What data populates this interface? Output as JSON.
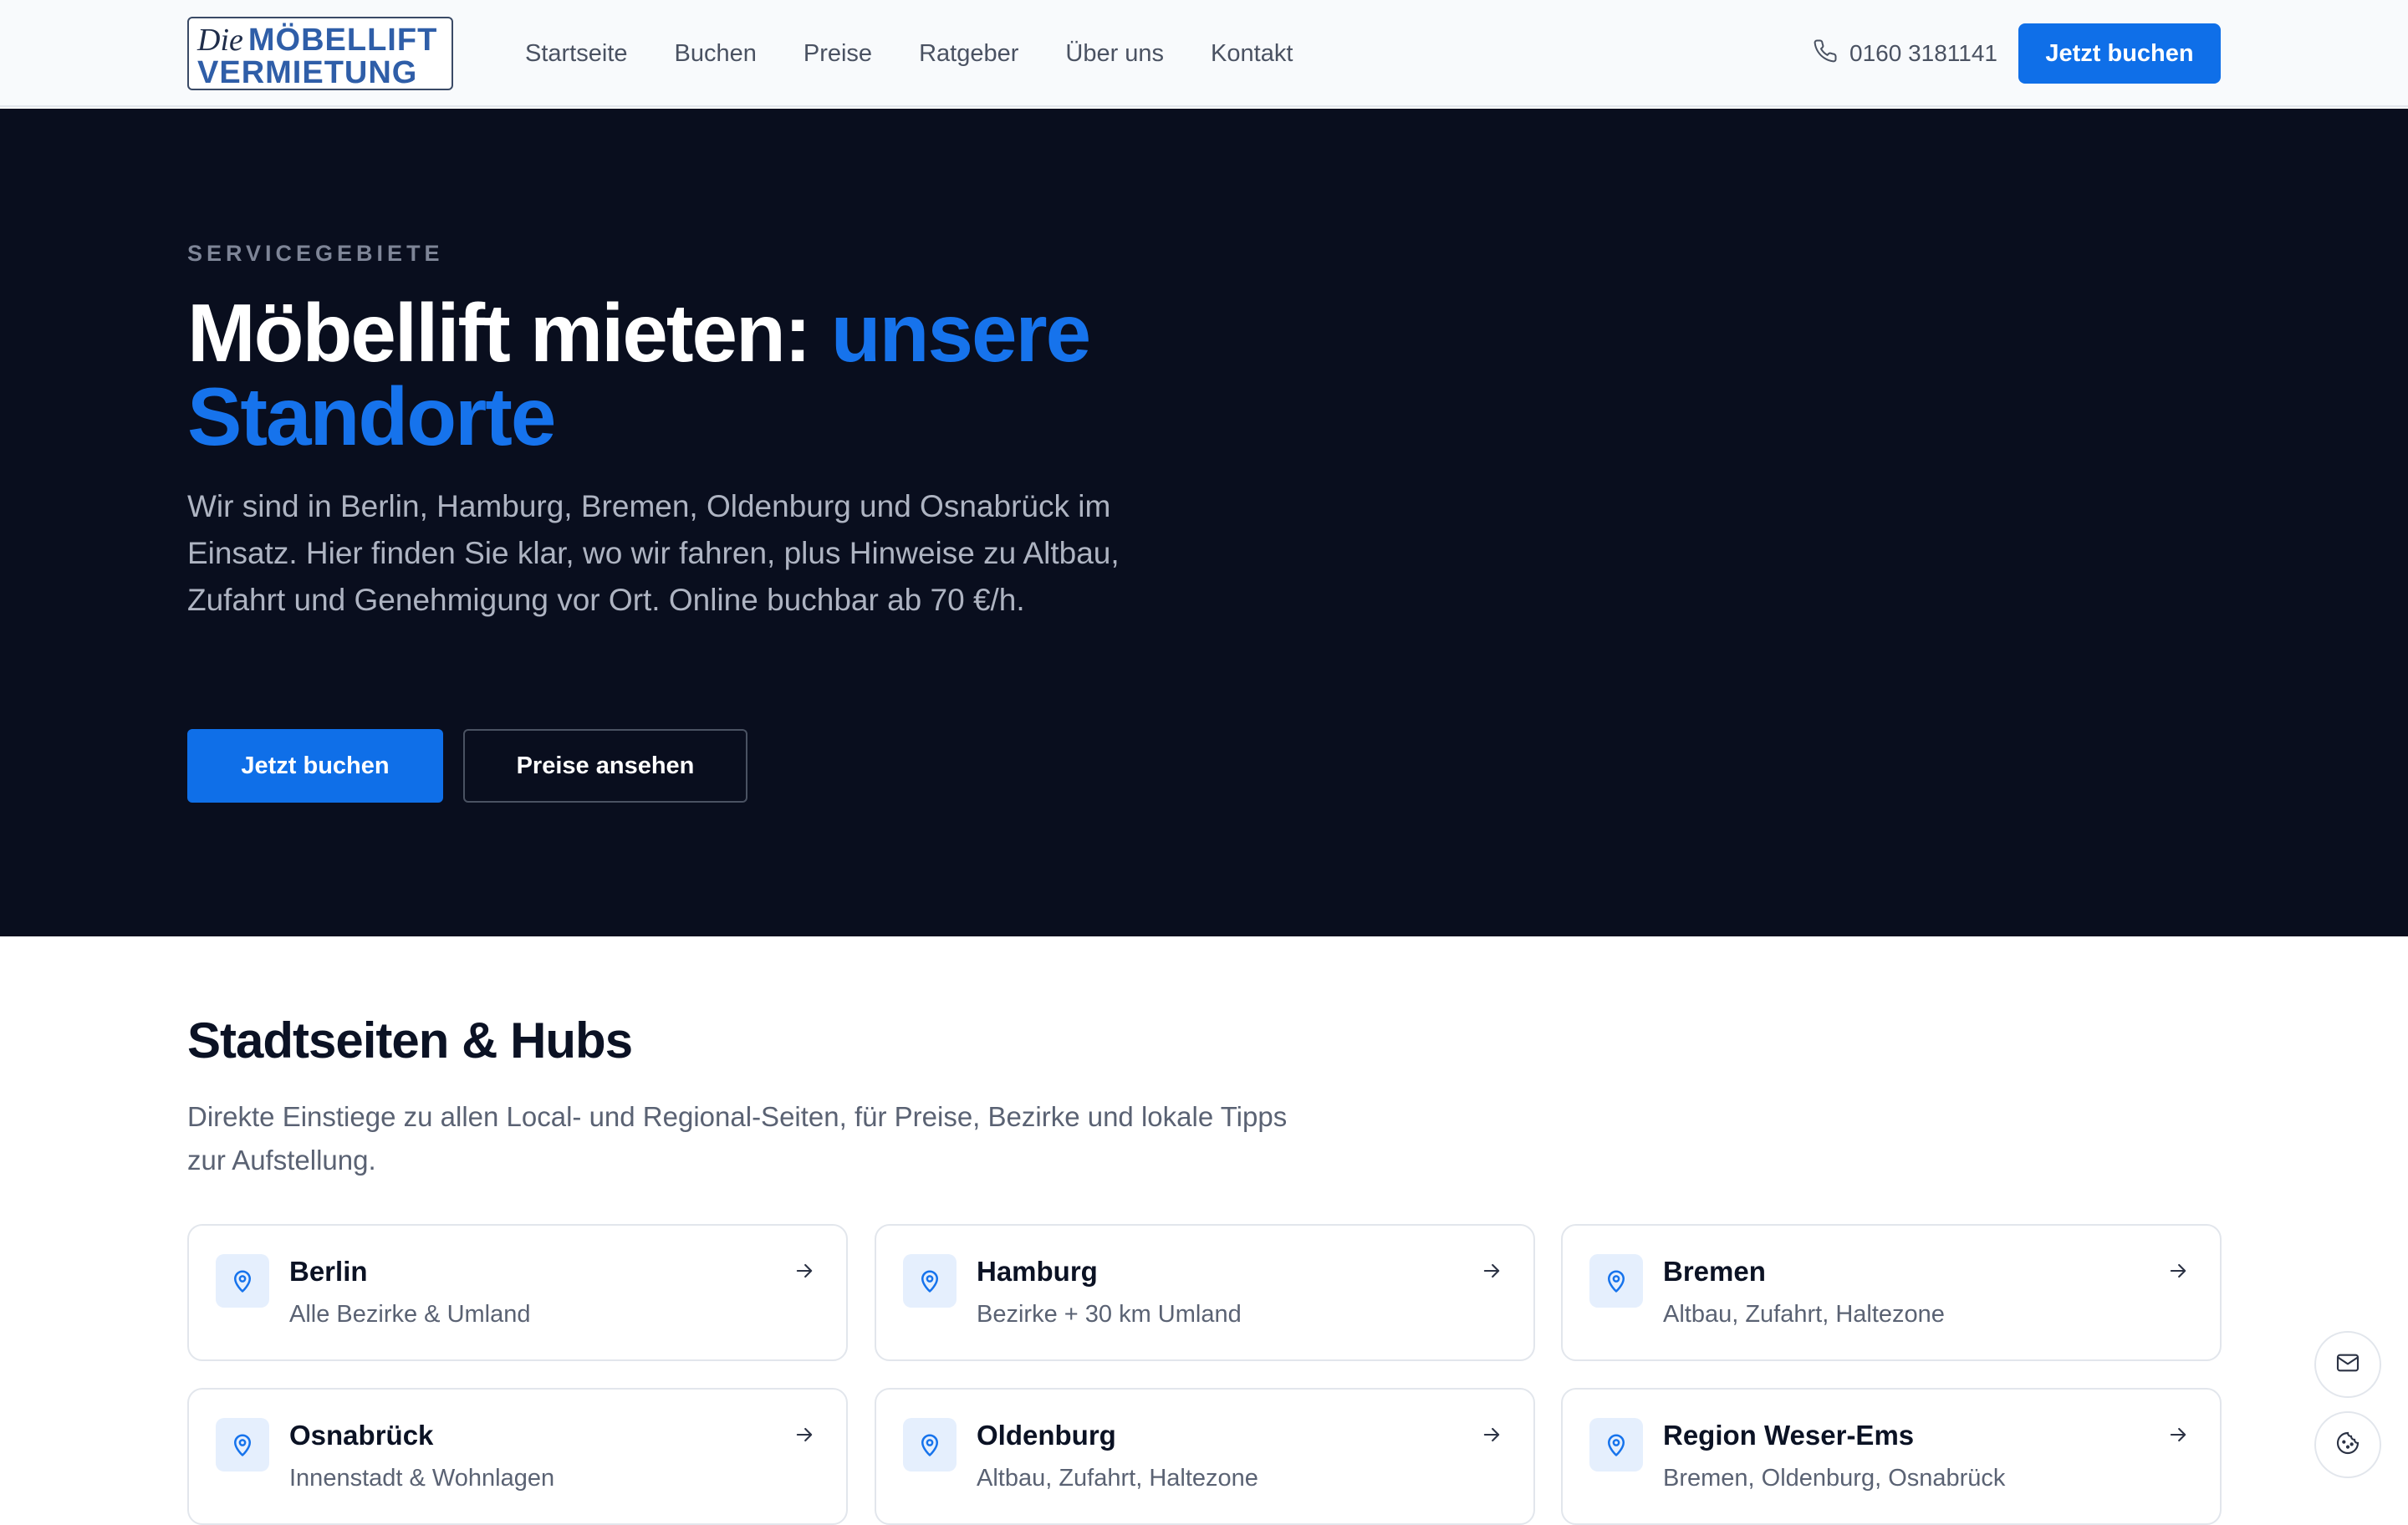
{
  "nav": {
    "logo": {
      "line1_script": "Die",
      "line1_bold": "MÖBELLIFT",
      "line2": "VERMIETUNG"
    },
    "links": [
      "Startseite",
      "Buchen",
      "Preise",
      "Ratgeber",
      "Über uns",
      "Kontakt"
    ],
    "phone": "0160 3181141",
    "cta": "Jetzt buchen"
  },
  "hero": {
    "eyebrow": "SERVICEGEBIETE",
    "title_white": "Möbellift mieten:",
    "title_accent": "unsere Standorte",
    "lead": "Wir sind in Berlin, Hamburg, Bremen, Oldenburg und Osnabrück im Einsatz. Hier finden Sie klar, wo wir fahren, plus Hinweise zu Altbau, Zufahrt und Genehmigung vor Ort. Online buchbar ab 70 €/h.",
    "primary_button": "Jetzt buchen",
    "secondary_button": "Preise ansehen"
  },
  "section": {
    "title": "Stadtseiten & Hubs",
    "lead": "Direkte Einstiege zu allen Local- und Regional-Seiten, für Preise, Bezirke und lokale Tipps zur Aufstellung.",
    "cards": [
      {
        "name": "Berlin",
        "desc": "Alle Bezirke & Umland"
      },
      {
        "name": "Hamburg",
        "desc": "Bezirke + 30 km Umland"
      },
      {
        "name": "Bremen",
        "desc": "Altbau, Zufahrt, Haltezone"
      },
      {
        "name": "Osnabrück",
        "desc": "Innenstadt & Wohnlagen"
      },
      {
        "name": "Oldenburg",
        "desc": "Altbau, Zufahrt, Haltezone"
      },
      {
        "name": "Region Weser-Ems",
        "desc": "Bremen, Oldenburg, Osnabrück"
      }
    ]
  },
  "icons": {
    "phone": "phone-icon",
    "pin": "map-pin-icon",
    "arrow": "arrow-right-icon",
    "mail": "mail-icon",
    "cookie": "cookie-icon"
  },
  "colors": {
    "accent": "#0f6fe8",
    "hero_bg": "#090e1e"
  }
}
